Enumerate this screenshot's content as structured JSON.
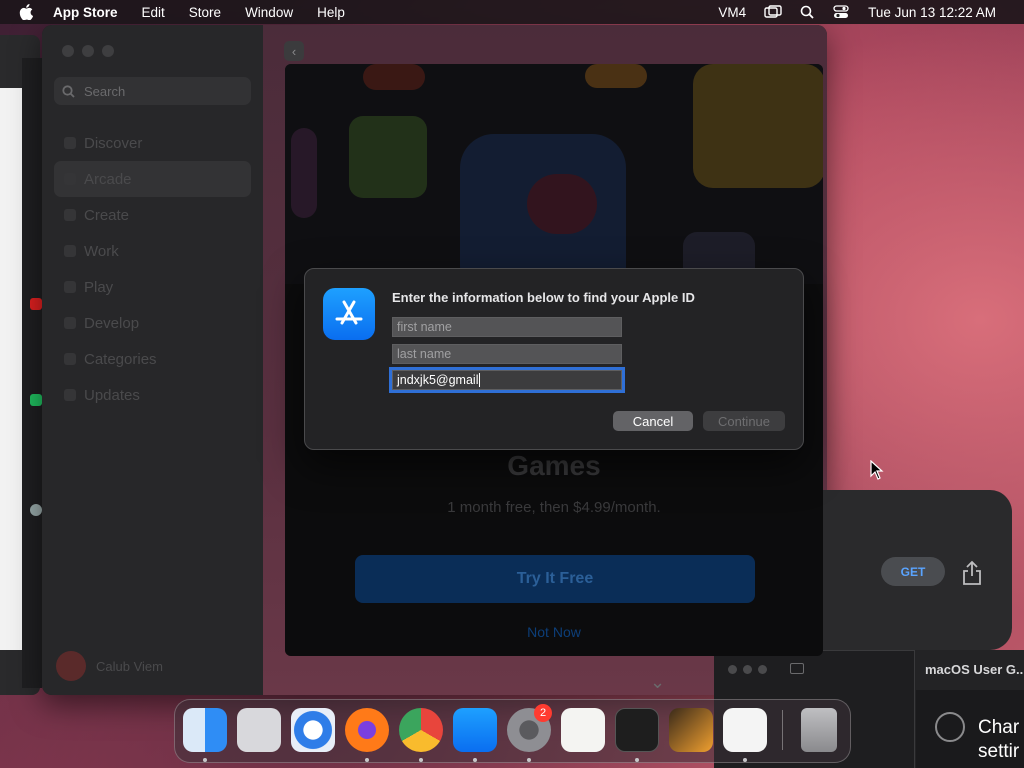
{
  "menubar": {
    "app_name": "App Store",
    "menus": [
      "Edit",
      "Store",
      "Window",
      "Help"
    ],
    "status_user": "VM4",
    "datetime": "Tue Jun 13  12:22 AM"
  },
  "sidebar": {
    "search_placeholder": "Search",
    "items": [
      {
        "label": "Discover",
        "active": false
      },
      {
        "label": "Arcade",
        "active": true
      },
      {
        "label": "Create",
        "active": false
      },
      {
        "label": "Work",
        "active": false
      },
      {
        "label": "Play",
        "active": false
      },
      {
        "label": "Develop",
        "active": false
      },
      {
        "label": "Categories",
        "active": false
      },
      {
        "label": "Updates",
        "active": false
      }
    ],
    "user_name": "Calub Viem"
  },
  "arcade_sheet": {
    "heading": "Games",
    "subtitle": "1 month free, then $4.99/month.",
    "try_button": "Try It Free",
    "not_now": "Not Now"
  },
  "right_card": {
    "get_button": "GET"
  },
  "dialog": {
    "title": "Enter the information below to find your Apple ID",
    "first_name_placeholder": "first name",
    "last_name_placeholder": "last name",
    "email_value": "jndxjk5@gmail",
    "cancel_label": "Cancel",
    "continue_label": "Continue"
  },
  "guide_window": {
    "title": "macOS User G...",
    "text_line1": "Char",
    "text_line2": "settir"
  },
  "dock": {
    "apps": [
      {
        "name": "Finder",
        "color": "#2f8df5"
      },
      {
        "name": "Launchpad",
        "color": "#d8d8dc"
      },
      {
        "name": "Safari",
        "color": "#e8eef8"
      },
      {
        "name": "Firefox",
        "color": "#ff7a18"
      },
      {
        "name": "Chrome",
        "color": "#ffffff"
      },
      {
        "name": "App Store",
        "color": "#1a8cff"
      },
      {
        "name": "System Settings",
        "color": "#8e8e93"
      },
      {
        "name": "TextEdit",
        "color": "#f4f4f2"
      },
      {
        "name": "Terminal",
        "color": "#1e1e1e"
      },
      {
        "name": "GarageBand",
        "color": "#f0a030"
      },
      {
        "name": "Visual Studio Code",
        "color": "#2b8fe0"
      }
    ],
    "settings_badge": "2",
    "trash_label": "Trash"
  }
}
